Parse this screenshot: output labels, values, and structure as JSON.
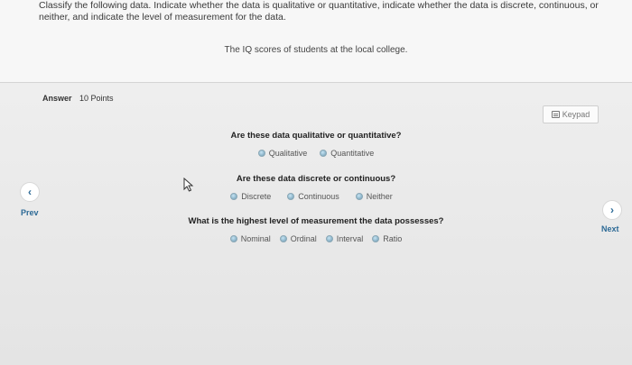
{
  "question": {
    "instructions": "Classify the following data. Indicate whether the data is qualitative or quantitative, indicate whether the data is discrete, continuous, or neither, and indicate the level of measurement for the data.",
    "data": "The IQ scores of students at the local college."
  },
  "answer": {
    "label": "Answer",
    "points": "10 Points"
  },
  "keypad": {
    "label": "Keypad",
    "icon": "keypad-icon"
  },
  "parts": [
    {
      "question": "Are these data qualitative or quantitative?",
      "options": [
        "Qualitative",
        "Quantitative"
      ]
    },
    {
      "question": "Are these data discrete or continuous?",
      "options": [
        "Discrete",
        "Continuous",
        "Neither"
      ]
    },
    {
      "question": "What is the highest level of measurement the data possesses?",
      "options": [
        "Nominal",
        "Ordinal",
        "Interval",
        "Ratio"
      ]
    }
  ],
  "nav": {
    "prev_label": "Prev",
    "prev_icon": "chevron-left-icon",
    "next_label": "Next",
    "next_icon": "chevron-right-icon"
  },
  "colors": {
    "nav_accent": "#2d6a96",
    "radio": "#8fb7cc"
  }
}
